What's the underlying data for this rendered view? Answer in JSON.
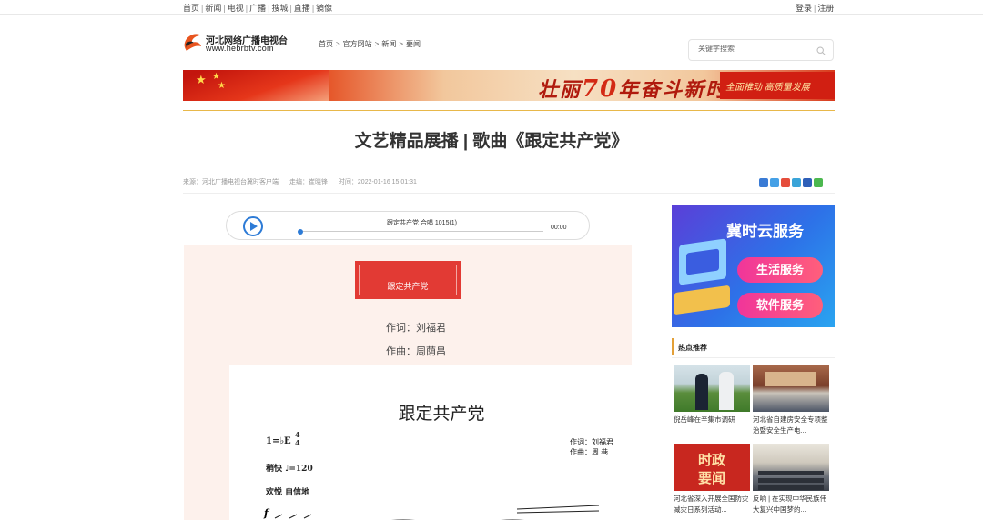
{
  "topnav": {
    "links": [
      "首页",
      "新闻",
      "电视",
      "广播",
      "搜城",
      "直播",
      "镜像"
    ],
    "separator": "|",
    "login": "登录",
    "register": "注册"
  },
  "logo": {
    "cn": "河北网络广播电视台",
    "en": "www.hebrbtv.com"
  },
  "breadcrumb": [
    "首页",
    "官方网站",
    "新闻",
    "要闻"
  ],
  "breadcrumb_sep": ">",
  "search": {
    "placeholder": "关键字搜索"
  },
  "banner": {
    "slogan_a": "壮丽",
    "slogan_70": "70",
    "slogan_b": "年奋斗新时代",
    "right": "全面推动 高质量发展"
  },
  "article": {
    "title": "文艺精品展播 | 歌曲《跟定共产党》",
    "source": "来源：河北广播电视台冀时客户端",
    "editor": "走编：崔晓锋",
    "time": "时间：2022-01-16 15:01:31"
  },
  "player": {
    "song": "跟定共产党 合唱 1015(1)",
    "time": "00:00"
  },
  "content": {
    "song_box": "跟定共产党",
    "lyricist": "作词：刘福君",
    "composer": "作曲：周荫昌"
  },
  "sheet": {
    "title": "跟定共产党",
    "key": "1=♭E",
    "meter_top": "4",
    "meter_bottom": "4",
    "tempo": "稍快 ♩=120",
    "mood": "欢悦 自信地",
    "credit_1": "作词：刘福君",
    "credit_2": "作曲：周  巷"
  },
  "ad": {
    "title": "冀时云服务",
    "btn1": "生活服务",
    "btn2": "软件服务"
  },
  "hot": {
    "heading": "热点推荐",
    "items": [
      {
        "caption": "倪岳峰在辛集市调研"
      },
      {
        "caption": "河北省自建房安全专项整治暨安全生产电..."
      },
      {
        "caption": "河北省深入开展全国防灾减灾日系列活动...",
        "image_text_1": "时政",
        "image_text_2": "要闻"
      },
      {
        "caption": "反响 | 在实现中华民族伟大复兴中国梦的..."
      }
    ]
  },
  "colors": {
    "accent_blue": "#2d7bd6",
    "accent_red": "#e23a34",
    "rule_gold": "#e8b84a"
  }
}
